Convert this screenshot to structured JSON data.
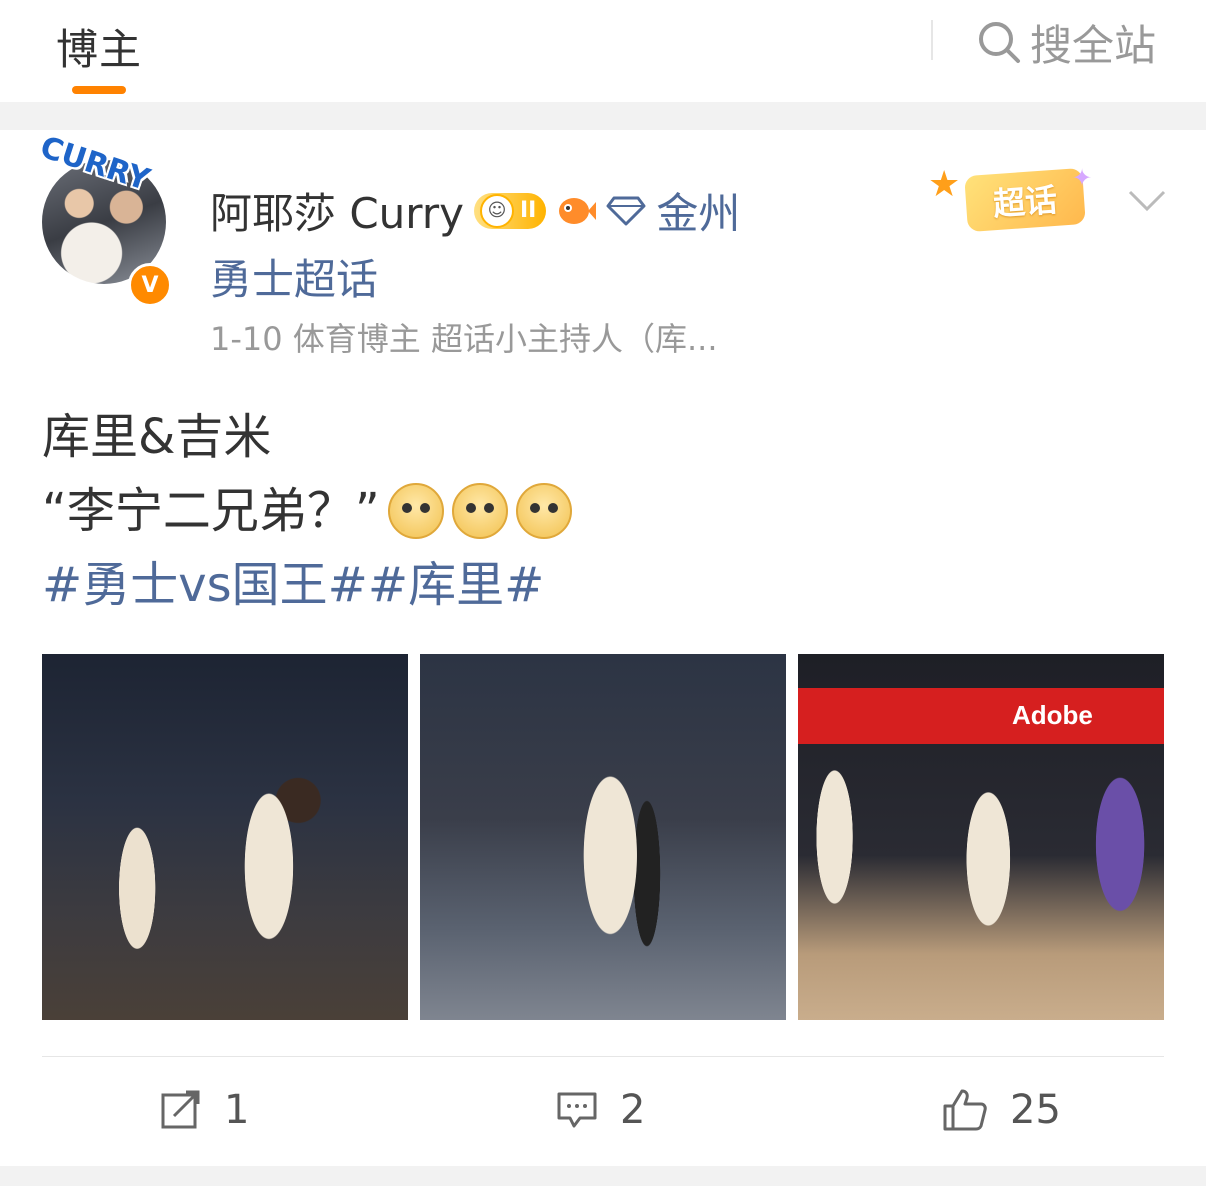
{
  "header": {
    "tab_label": "博主",
    "search_label": "搜全站",
    "accent_color": "#ff8200"
  },
  "post": {
    "author": "阿耶莎 Curry",
    "level_badge": "II",
    "location": "金州",
    "topic_line": "勇士超话",
    "meta": "1-10  体育博主 超话小主持人（库...",
    "supertopic_label": "超话",
    "avatar_caption": "CURRY",
    "verified_mark": "V",
    "text_line1": "库里&吉米",
    "text_line2": "“李宁二兄弟？”",
    "hashtags": "#勇士vs国王##库里#",
    "photo3_ad": "Adobe",
    "link_color": "#4f6a99"
  },
  "actions": {
    "share_count": "1",
    "comment_count": "2",
    "like_count": "25"
  },
  "icons": [
    "search-icon",
    "verified-icon",
    "astronaut-icon",
    "fish-icon",
    "diamond-icon",
    "chevron-down-icon",
    "share-icon",
    "comment-icon",
    "like-icon"
  ]
}
